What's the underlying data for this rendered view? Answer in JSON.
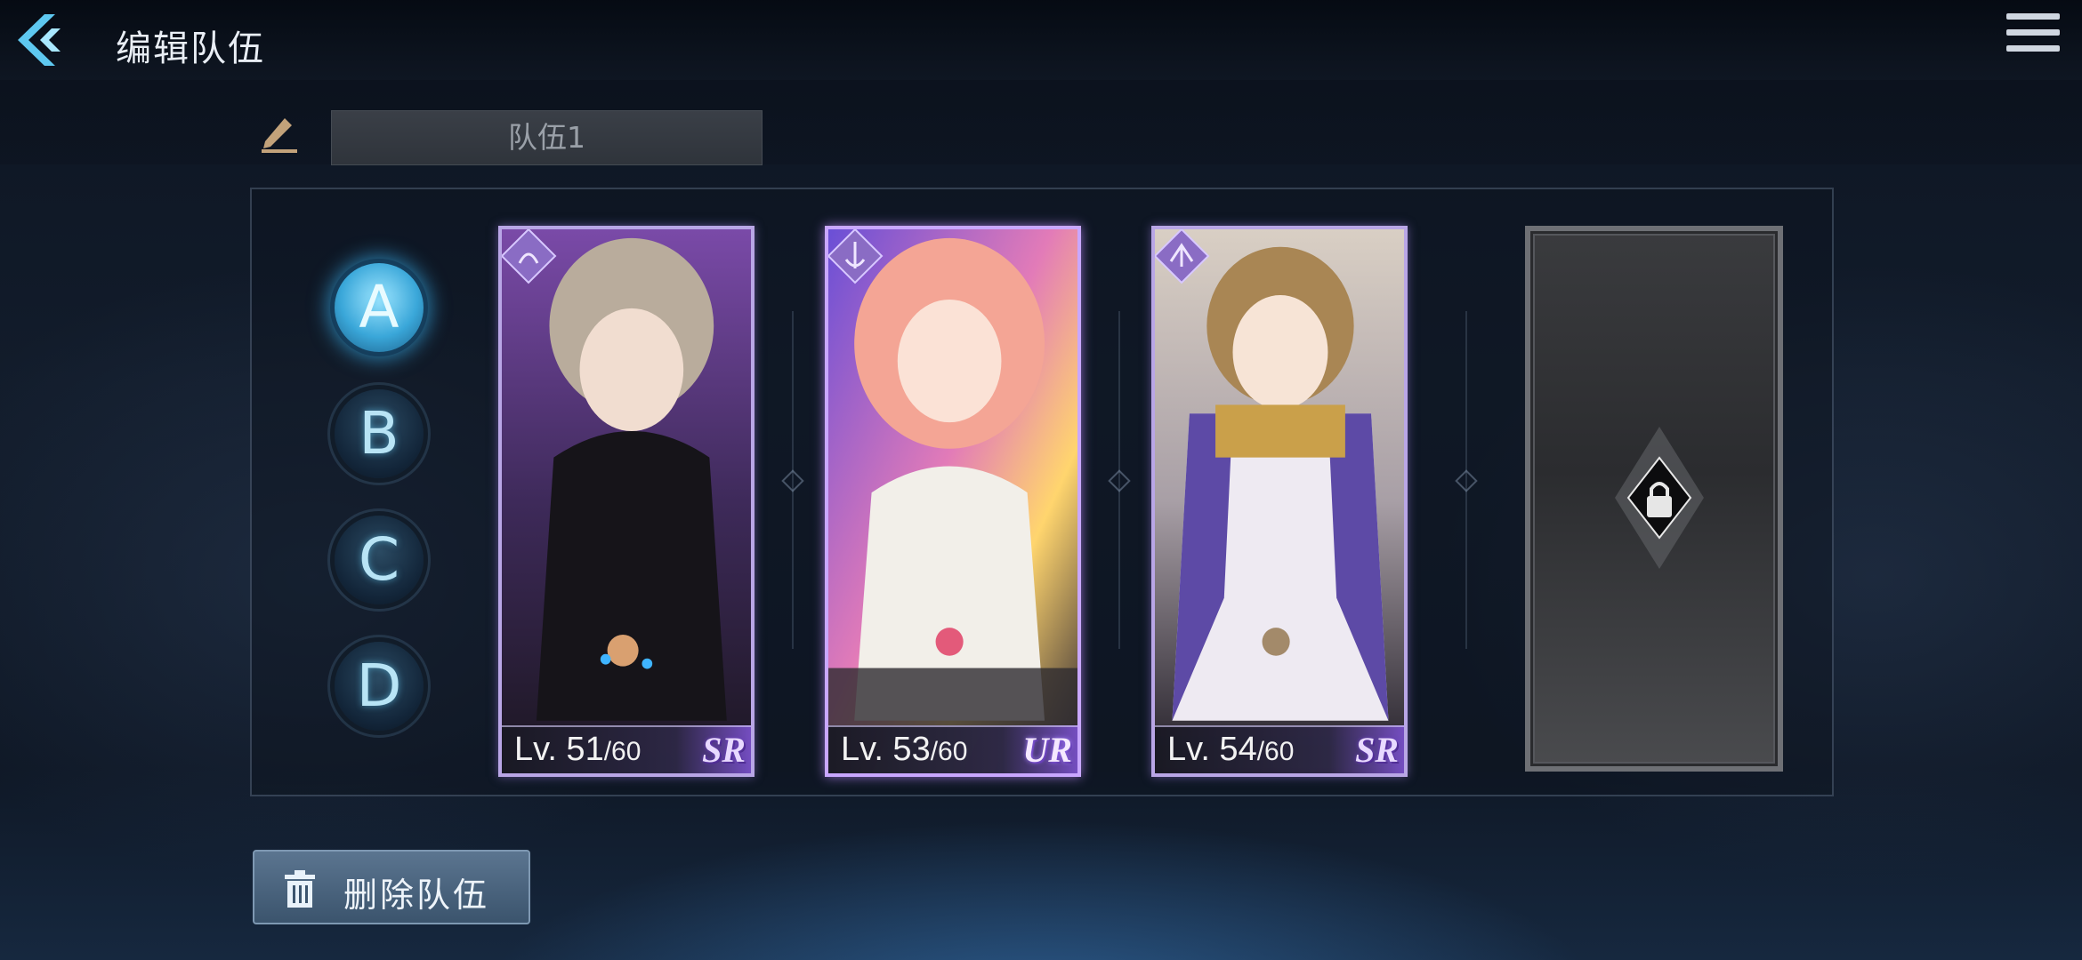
{
  "header": {
    "title": "编辑队伍",
    "back_icon": "chevron-left-icon",
    "menu_icon": "hamburger-menu-icon"
  },
  "team_name": {
    "edit_icon": "pencil-icon",
    "value": "队伍1"
  },
  "slots": [
    {
      "label": "A",
      "active": true
    },
    {
      "label": "B",
      "active": false
    },
    {
      "label": "C",
      "active": false
    },
    {
      "label": "D",
      "active": false
    }
  ],
  "characters": [
    {
      "level": "Lv. 51",
      "max": "/60",
      "rarity": "SR",
      "class_icon": "wing-emblem-icon"
    },
    {
      "level": "Lv. 53",
      "max": "/60",
      "rarity": "UR",
      "class_icon": "anchor-emblem-icon"
    },
    {
      "level": "Lv. 54",
      "max": "/60",
      "rarity": "SR",
      "class_icon": "crest-emblem-icon"
    }
  ],
  "locked_slot": {
    "icon": "lock-icon"
  },
  "delete_button": {
    "label": "删除队伍",
    "icon": "trash-icon"
  },
  "colors": {
    "active_slot": "#3aa7d9",
    "card_border_sr": "#b9a6e6",
    "card_border_ur": "#c9a7ff"
  }
}
